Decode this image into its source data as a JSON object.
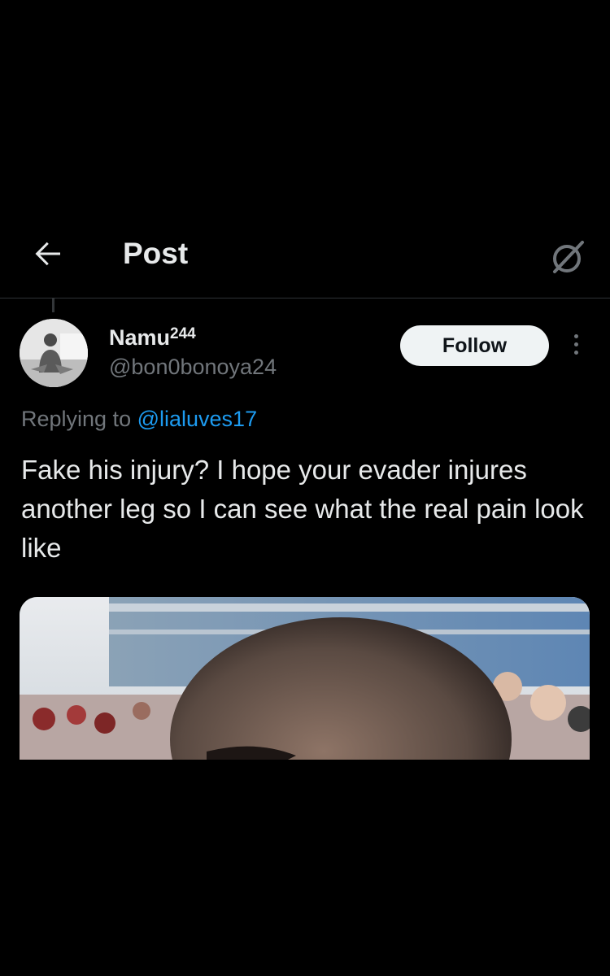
{
  "header": {
    "title": "Post",
    "back_icon": "arrow-left-icon",
    "grok_icon": "grok-icon"
  },
  "post": {
    "author": {
      "display_name": "Namu",
      "display_name_sup": "244",
      "handle": "@bon0bonoya24"
    },
    "follow_label": "Follow",
    "more_icon": "more-vertical-icon",
    "replying_prefix": "Replying to ",
    "replying_to": "@lialuves17",
    "text": "Fake his injury? I hope your evader injures another leg so I can see what the real pain look like"
  },
  "colors": {
    "background": "#000000",
    "text_primary": "#e7e9ea",
    "text_secondary": "#71767b",
    "link": "#1d9bf0",
    "divider": "#2f3336",
    "follow_bg": "#eff3f4"
  }
}
